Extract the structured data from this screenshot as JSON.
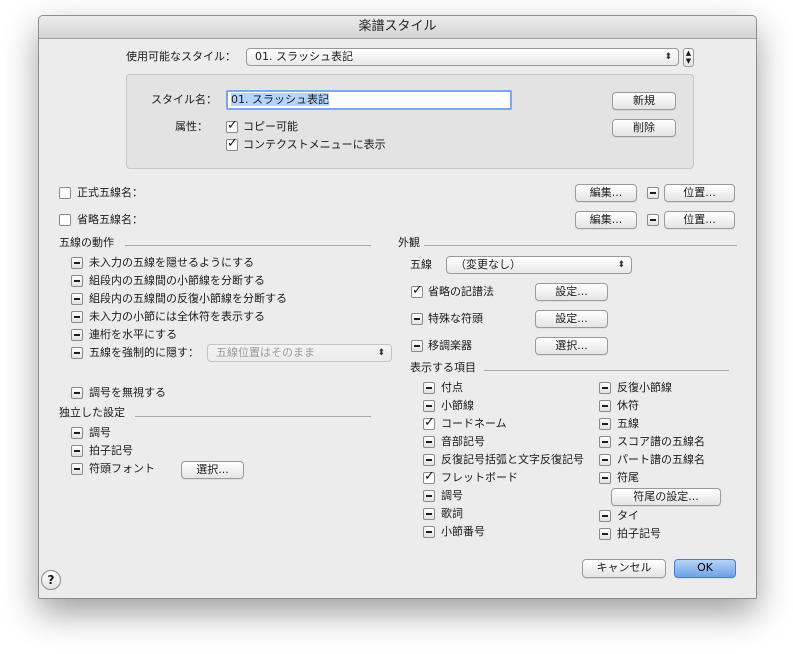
{
  "window": {
    "title": "楽譜スタイル"
  },
  "top": {
    "available_label": "使用可能なスタイル：",
    "available_value": "01. スラッシュ表記",
    "style_name_label": "スタイル名：",
    "style_name_value": "01. スラッシュ表記",
    "new_button": "新規",
    "delete_button": "削除",
    "attributes_label": "属性：",
    "attr_copyable": "コピー可能",
    "attr_context_menu": "コンテクストメニューに表示"
  },
  "staff_names": {
    "full_label": "正式五線名：",
    "abbr_label": "省略五線名：",
    "edit_button": "編集...",
    "position_button": "位置..."
  },
  "staff_behavior": {
    "heading": "五線の動作",
    "items": [
      "未入力の五線を隠せるようにする",
      "組段内の五線間の小節線を分断する",
      "組段内の五線間の反復小節線を分断する",
      "未入力の小節には全休符を表示する",
      "連桁を水平にする",
      "五線を強制的に隠す："
    ],
    "force_hide_value": "五線位置はそのまま",
    "ignore_key": "調号を無視する"
  },
  "independent": {
    "heading": "独立した設定",
    "items": [
      "調号",
      "拍子記号",
      "符頭フォント"
    ],
    "select_button": "選択..."
  },
  "appearance": {
    "heading": "外観",
    "staff_label": "五線",
    "staff_value": "（変更なし）",
    "rows": [
      {
        "label": "省略の記譜法",
        "button": "設定..."
      },
      {
        "label": "特殊な符頭",
        "button": "設定..."
      },
      {
        "label": "移調楽器",
        "button": "選択..."
      }
    ]
  },
  "display_items": {
    "heading": "表示する項目",
    "col1": [
      "付点",
      "小節線",
      "コードネーム",
      "音部記号",
      "反復記号括弧と文字反復記号",
      "フレットボード",
      "調号",
      "歌詞",
      "小節番号"
    ],
    "col2": [
      "反復小節線",
      "休符",
      "五線",
      "スコア譜の五線名",
      "パート譜の五線名",
      "符尾"
    ],
    "stem_settings_button": "符尾の設定...",
    "col2_after": [
      "タイ",
      "拍子記号"
    ]
  },
  "footer": {
    "cancel": "キャンセル",
    "ok": "OK",
    "help": "?"
  }
}
